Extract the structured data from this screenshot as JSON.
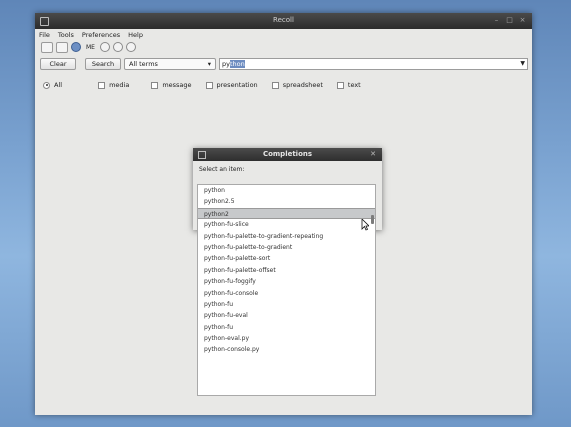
{
  "window": {
    "title": "Recoll"
  },
  "menu": [
    "File",
    "Tools",
    "Preferences",
    "Help"
  ],
  "toolbar": {
    "nav_label": "ME"
  },
  "search": {
    "clear_label": "Clear",
    "search_label": "Search",
    "mode_value": "All terms",
    "query_prefix": "py",
    "query_selected": "thon"
  },
  "filters": [
    {
      "label": "All",
      "type": "radio",
      "checked": true
    },
    {
      "label": "media",
      "type": "check",
      "checked": false
    },
    {
      "label": "message",
      "type": "check",
      "checked": false
    },
    {
      "label": "presentation",
      "type": "check",
      "checked": false
    },
    {
      "label": "spreadsheet",
      "type": "check",
      "checked": false
    },
    {
      "label": "text",
      "type": "check",
      "checked": false
    }
  ],
  "completions": {
    "title": "Completions",
    "prompt": "Select an item:",
    "items": [
      "python",
      "python2.5",
      "python2",
      "python-fu-slice",
      "python-fu-palette-to-gradient-repeating",
      "python-fu-palette-to-gradient",
      "python-fu-palette-sort",
      "python-fu-palette-offset",
      "python-fu-foggify",
      "python-fu-console",
      "python-fu",
      "python-fu-eval",
      "python-fu",
      "python-eval.py",
      "python-console.py"
    ],
    "selected_index": 2
  }
}
